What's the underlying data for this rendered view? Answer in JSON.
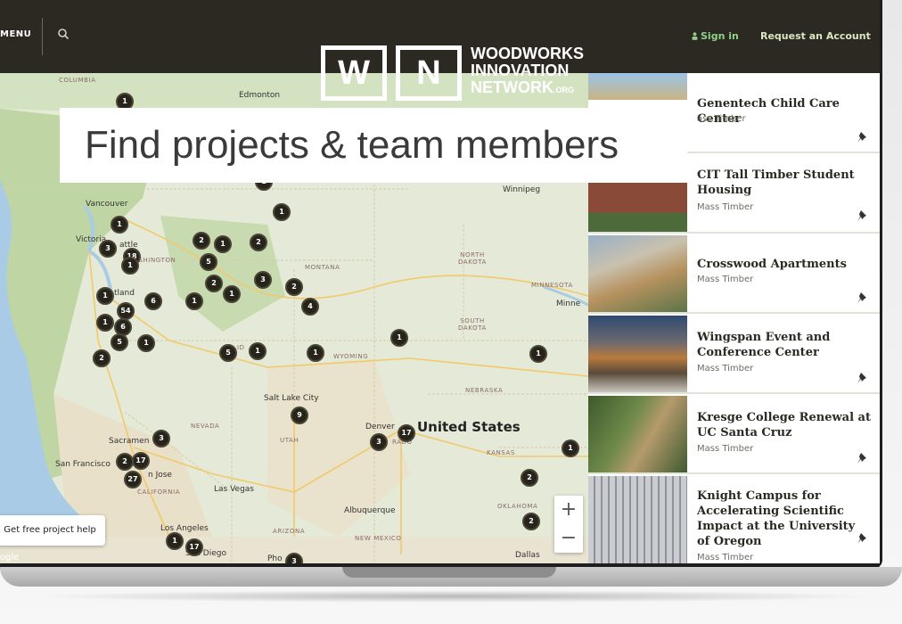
{
  "nav": {
    "menu_label": "MENU",
    "search_icon": "search-icon",
    "sign_in_label": "Sign in",
    "request_label": "Request an Account",
    "user_icon": "user-icon"
  },
  "logo": {
    "letter_w": "W",
    "letter_n": "N",
    "line1": "WOODWORKS",
    "line2": "INNOVATION",
    "line3": "NETWORK",
    "suffix": ".ORG"
  },
  "headline": "Find projects & team members",
  "map": {
    "country_label": "United States",
    "places": [
      {
        "id": "edmonton",
        "label": "Edmonton"
      },
      {
        "id": "winnipeg",
        "label": "Winnipeg"
      },
      {
        "id": "vancouver",
        "label": "Vancouver"
      },
      {
        "id": "victoria",
        "label": "Victoria"
      },
      {
        "id": "seattle",
        "label": "attle"
      },
      {
        "id": "portland",
        "label": "tland"
      },
      {
        "id": "slc",
        "label": "Salt Lake City"
      },
      {
        "id": "denver",
        "label": "Denver"
      },
      {
        "id": "sacramento",
        "label": "Sacramen"
      },
      {
        "id": "sf",
        "label": "San Francisco"
      },
      {
        "id": "sanjose",
        "label": "n Jose"
      },
      {
        "id": "vegas",
        "label": "Las Vegas"
      },
      {
        "id": "albuquerque",
        "label": "Albuquerque"
      },
      {
        "id": "la",
        "label": "Los Angeles"
      },
      {
        "id": "sd",
        "label": "San Diego"
      },
      {
        "id": "phoenix",
        "label": "Pho"
      },
      {
        "id": "dallas",
        "label": "Dallas"
      },
      {
        "id": "minne",
        "label": "Minne"
      }
    ],
    "states": [
      {
        "id": "columbia",
        "label": "COLUMBIA"
      },
      {
        "id": "washington",
        "label": "ASHINGTON"
      },
      {
        "id": "montana",
        "label": "MONTANA"
      },
      {
        "id": "nd",
        "label": "NORTH DAKOTA"
      },
      {
        "id": "sd",
        "label": "SOUTH DAKOTA"
      },
      {
        "id": "minnesota",
        "label": "MINNESOTA"
      },
      {
        "id": "wyoming",
        "label": "WYOMING"
      },
      {
        "id": "nebraska",
        "label": "NEBRASKA"
      },
      {
        "id": "nevada",
        "label": "NEVADA"
      },
      {
        "id": "utah",
        "label": "UTAH"
      },
      {
        "id": "colorado",
        "label": "RADO"
      },
      {
        "id": "kansas",
        "label": "KANSAS"
      },
      {
        "id": "california",
        "label": "CALIFORNIA"
      },
      {
        "id": "arizona",
        "label": "ARIZONA"
      },
      {
        "id": "newmexico",
        "label": "NEW MEXICO"
      },
      {
        "id": "oklahoma",
        "label": "OKLAHOMA"
      },
      {
        "id": "idaho",
        "label": "ID"
      }
    ],
    "clusters": [
      "1",
      "1",
      "1",
      "1",
      "3",
      "18",
      "2",
      "1",
      "5",
      "2",
      "1",
      "2",
      "2",
      "1",
      "1",
      "3",
      "2",
      "6",
      "4",
      "1",
      "1",
      "54",
      "6",
      "1",
      "5",
      "1",
      "1",
      "5",
      "1",
      "2",
      "1",
      "9",
      "3",
      "3",
      "17",
      "2",
      "27",
      "17",
      "1",
      "17",
      "3",
      "2",
      "2",
      "1"
    ],
    "help_button": "Get free project help",
    "zoom_in": "+",
    "zoom_out": "−",
    "google_label": "ogle",
    "colors": {
      "land": "#e4ead7",
      "forest": "#c9dbb4",
      "water": "#a9cbe6",
      "cluster": "#27241c",
      "roads": "#f2c96a"
    }
  },
  "projects": [
    {
      "title": "Genentech Child Care Center",
      "category": "ass Timber"
    },
    {
      "title": "CIT Tall Timber Student Housing",
      "category": "Mass Timber"
    },
    {
      "title": "Crosswood Apartments",
      "category": "Mass Timber"
    },
    {
      "title": "Wingspan Event and Conference Center",
      "category": "Mass Timber"
    },
    {
      "title": "Kresge College Renewal at UC Santa Cruz",
      "category": "Mass Timber"
    },
    {
      "title": "Knight Campus for Accelerating Scientific Impact at the University of Oregon",
      "category": "Mass Timber"
    }
  ]
}
